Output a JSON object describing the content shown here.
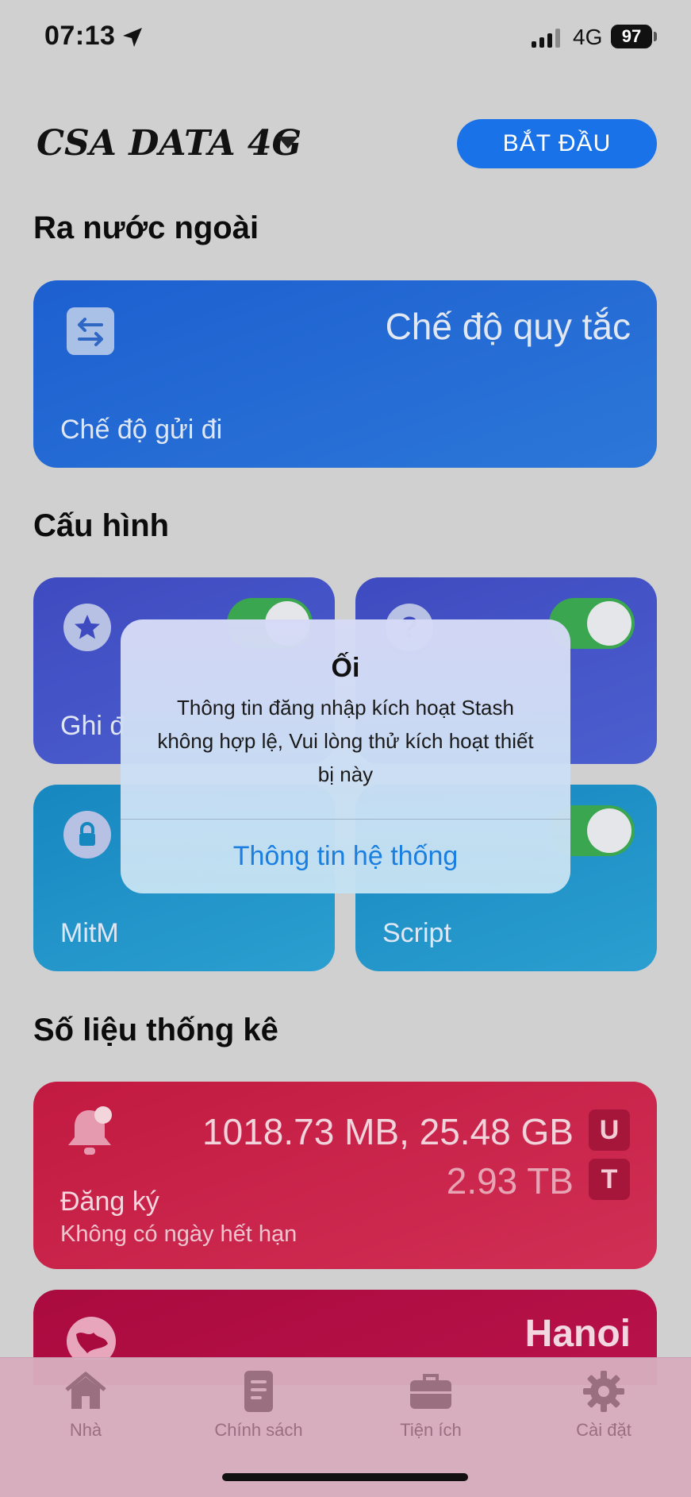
{
  "status_bar": {
    "time": "07:13",
    "network": "4G",
    "battery": "97"
  },
  "header": {
    "profile_name": "CSA DATA 4G",
    "start_button": "BẮT ĐẦU"
  },
  "outbound": {
    "section_title": "Ra nước ngoài",
    "mode_title": "Chế độ quy tắc",
    "mode_subtitle": "Chế độ gửi đi"
  },
  "config": {
    "section_title": "Cấu hình",
    "cards": [
      {
        "label": "Ghi đ",
        "icon": "star-icon",
        "enabled": true
      },
      {
        "label": "",
        "icon": "question-icon",
        "enabled": true
      },
      {
        "label": "MitM",
        "icon": "lock-icon",
        "enabled": true
      },
      {
        "label": "Script",
        "icon": "code-icon",
        "enabled": true
      }
    ]
  },
  "stats": {
    "section_title": "Số liệu thống kê",
    "usage": "1018.73 MB, 25.48 GB",
    "usage_badge": "U",
    "total": "2.93 TB",
    "total_badge": "T",
    "subscription_title": "Đăng ký",
    "subscription_expiry": "Không có ngày hết hạn",
    "region": "Hanoi"
  },
  "alert": {
    "title": "Ối",
    "message": "Thông tin đăng nhập kích hoạt Stash không hợp lệ, Vui lòng thử kích hoạt thiết bị này",
    "button": "Thông tin hệ thống"
  },
  "tabs": [
    {
      "label": "Nhà",
      "icon": "home-icon"
    },
    {
      "label": "Chính sách",
      "icon": "document-icon"
    },
    {
      "label": "Tiện ích",
      "icon": "briefcase-icon"
    },
    {
      "label": "Cài đặt",
      "icon": "gear-icon"
    }
  ],
  "colors": {
    "accent": "#1a72e8",
    "outbound_card": "#1d5fd0",
    "config_card_purple": "#3e4bc0",
    "config_card_teal": "#1787c0",
    "subscription_card": "#c21a41",
    "toggle_on": "#3aa64f",
    "tabbar": "#d6acbc",
    "alert_link": "#1a7fe0"
  }
}
